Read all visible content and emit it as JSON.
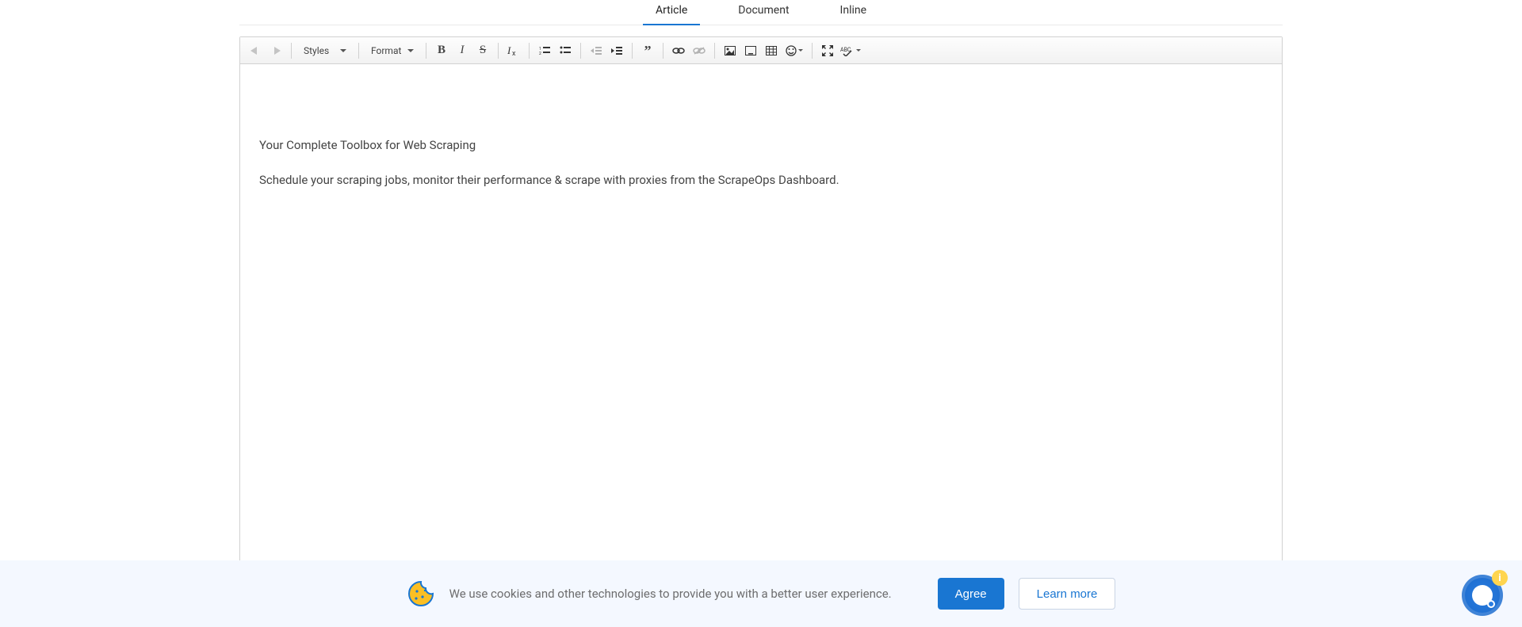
{
  "tabs": [
    {
      "label": "Article",
      "active": true
    },
    {
      "label": "Document",
      "active": false
    },
    {
      "label": "Inline",
      "active": false
    }
  ],
  "toolbar": {
    "styles_label": "Styles",
    "format_label": "Format"
  },
  "editor": {
    "p1": "Your Complete Toolbox for Web Scraping",
    "p2": "Schedule your scraping jobs, monitor their performance & scrape with proxies from the ScrapeOps Dashboard."
  },
  "cookies": {
    "text": "We use cookies and other technologies to provide you with a better user experience.",
    "agree": "Agree",
    "learn": "Learn more"
  },
  "chat": {
    "badge": "i"
  }
}
